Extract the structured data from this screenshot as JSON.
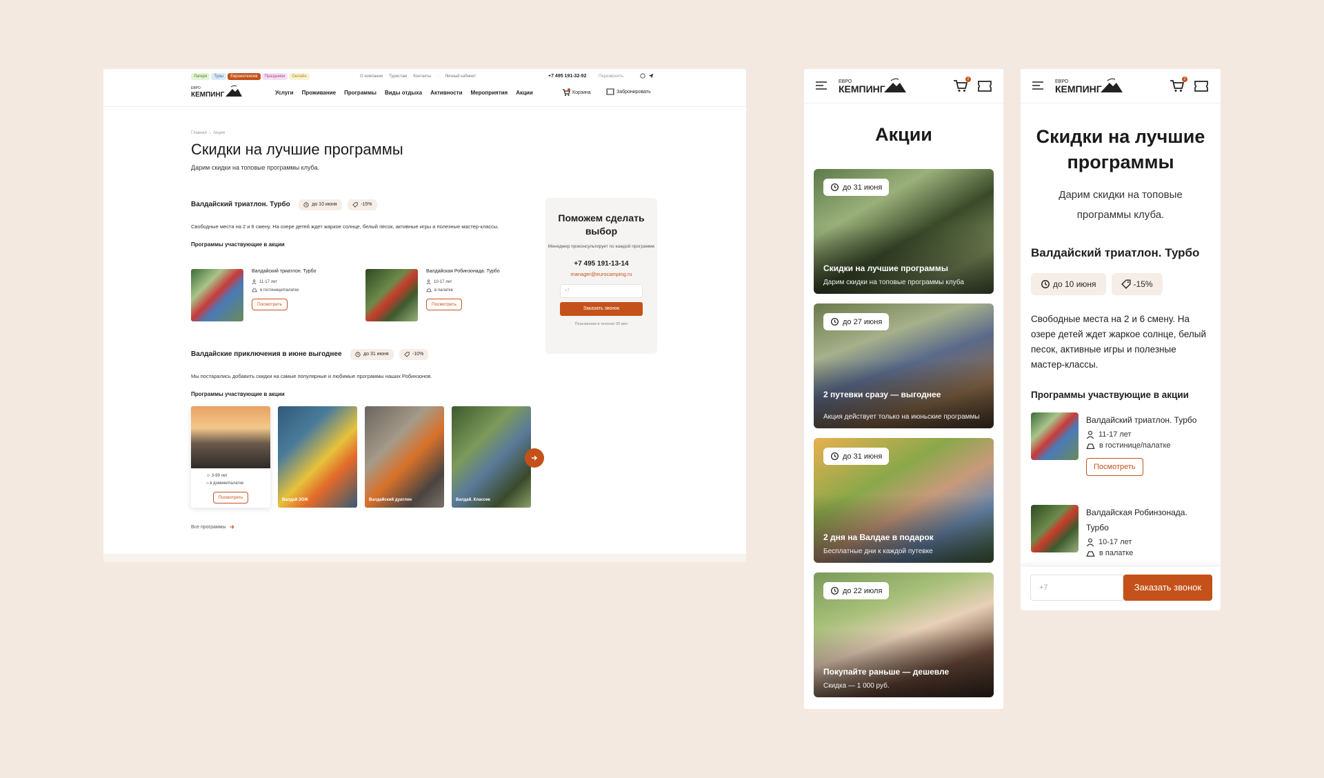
{
  "brand": {
    "logo_top": "ЕВРО",
    "logo_bottom": "КЕМПИНГ",
    "accent": "#c4511a",
    "background": "#f3e9e0"
  },
  "desktop": {
    "tags": [
      {
        "label": "Лагеря",
        "bg": "#e5f3d6",
        "color": "#4a8a2a"
      },
      {
        "label": "Туры",
        "bg": "#dcebf7",
        "color": "#3a6e9a"
      },
      {
        "label": "Евроинтенсив",
        "bg": "#c4511a",
        "color": "#ffffff"
      },
      {
        "label": "Праздники",
        "bg": "#f6e0f1",
        "color": "#a6488e"
      },
      {
        "label": "Онлайн",
        "bg": "#fbf2d4",
        "color": "#b08a1a"
      }
    ],
    "topnav": [
      "О компании",
      "Туристам",
      "Контакты",
      "·",
      "Личный кабинет"
    ],
    "phone": "+7 495 191-32-92",
    "callback": "Перезвонить",
    "mainnav": [
      "Услуги",
      "Проживание",
      "Программы",
      "Виды отдыха",
      "Активности",
      "Мероприятия",
      "Акции"
    ],
    "cart_label": "Корзина",
    "book_label": "Забронировать",
    "breadcrumb": "Главная  →  Акции",
    "title": "Скидки на лучшие программы",
    "subtitle": "Дарим скидки на топовые программы клуба.",
    "section1": {
      "title": "Валдайский триатлон. Турбо",
      "date": "до 10 июня",
      "discount": "-15%",
      "desc": "Свободные места на 2 и 6 смену. На озере детей ждет жаркое солнце, белый песок, активные игры и полезные мастер-классы.",
      "participating": "Программы участвующие в акции",
      "programs": [
        {
          "name": "Валдайский триатлон. Турбо",
          "age": "11-17 лет",
          "stay": "в гостинице/палатке",
          "button": "Посмотреть"
        },
        {
          "name": "Валдайская Робинзонада. Турбо",
          "age": "10-17 лет",
          "stay": "в палатке",
          "button": "Посмотреть"
        }
      ]
    },
    "section2": {
      "title": "Валдайские приключения в июне выгоднее",
      "date": "до 31 июня",
      "discount": "-10%",
      "desc": "Мы постарались добавить скидки на самые популярные и любимые программы наших Робинзонов.",
      "participating": "Программы участвующие в акции",
      "card1": {
        "age": "3-99 лет",
        "stay": "в домике/палатке",
        "button": "Посмотреть"
      },
      "cards": [
        "Валдай ЗОЖ",
        "Валдайский дуатлон",
        "Валдай. Классик"
      ]
    },
    "all_programs": "Все программы",
    "help": {
      "title": "Поможем сделать выбор",
      "text": "Менеджер проконсультирует по каждой программе",
      "phone": "+7 495 191-13-14",
      "email": "manager@eurocamping.ru",
      "placeholder": "+7",
      "button": "Заказать звонок",
      "note": "Перезвоним в течении 30 мин"
    }
  },
  "mobile_list": {
    "cart_count": "2",
    "title": "Акции",
    "cards": [
      {
        "date": "до 31 июня",
        "title": "Скидки на лучшие программы",
        "sub": "Дарим скидки на топовые программы клуба"
      },
      {
        "date": "до 27 июня",
        "title": "2 путевки сразу — выгоднее",
        "sub": "Акция действует только на июньские программы"
      },
      {
        "date": "до 31 июня",
        "title": "2 дня на Валдае в подарок",
        "sub": "Бесплатные дни к каждой путевке"
      },
      {
        "date": "до 22 июля",
        "title": "Покупайте раньше — дешевле",
        "sub": "Скидка — 1 000 руб."
      }
    ]
  },
  "mobile_detail": {
    "cart_count": "2",
    "title": "Скидки на лучшие программы",
    "subtitle": "Дарим скидки на топовые программы клуба.",
    "section_title": "Валдайский триатлон. Турбо",
    "date": "до 10 июня",
    "discount": "-15%",
    "desc": "Свободные места на 2 и 6 смену. На озере детей ждет жаркое солнце, белый песок, активные игры и полезные мастер-классы.",
    "participating": "Программы участвующие в акции",
    "programs": [
      {
        "name": "Валдайский триатлон. Турбо",
        "age": "11-17 лет",
        "stay": "в гостинице/палатке",
        "button": "Посмотреть"
      },
      {
        "name": "Валдайская Робинзонада. Турбо",
        "age": "10-17 лет",
        "stay": "в палатке"
      }
    ],
    "placeholder": "+7",
    "button": "Заказать звонок"
  }
}
